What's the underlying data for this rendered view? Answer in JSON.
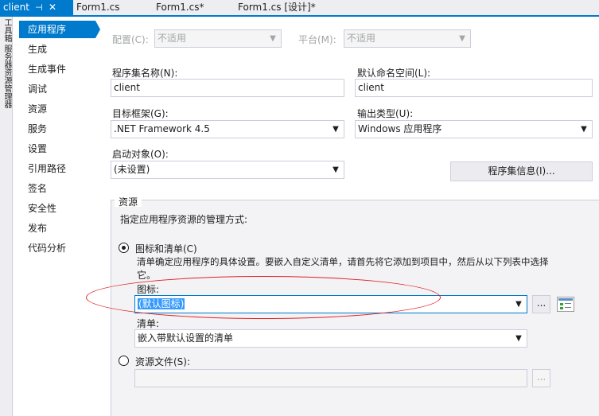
{
  "tabs": [
    {
      "label": "client",
      "pin": "⊣",
      "close": "✕",
      "active": true
    },
    {
      "label": "Form1.cs"
    },
    {
      "label": "Form1.cs*"
    },
    {
      "label": "Form1.cs [设计]*"
    }
  ],
  "toolstrip": {
    "text": "工具箱  服务器资源管理器"
  },
  "nav": {
    "items": [
      {
        "label": "应用程序",
        "selected": true
      },
      {
        "label": "生成"
      },
      {
        "label": "生成事件"
      },
      {
        "label": "调试"
      },
      {
        "label": "资源"
      },
      {
        "label": "服务"
      },
      {
        "label": "设置"
      },
      {
        "label": "引用路径"
      },
      {
        "label": "签名"
      },
      {
        "label": "安全性"
      },
      {
        "label": "发布"
      },
      {
        "label": "代码分析"
      }
    ]
  },
  "config": {
    "label": "配置(C):",
    "value": "不适用"
  },
  "platform": {
    "label": "平台(M):",
    "value": "不适用"
  },
  "assembly_name": {
    "label": "程序集名称(N):",
    "value": "client"
  },
  "default_namespace": {
    "label": "默认命名空间(L):",
    "value": "client"
  },
  "target_framework": {
    "label": "目标框架(G):",
    "value": ".NET Framework 4.5"
  },
  "output_type": {
    "label": "输出类型(U):",
    "value": "Windows 应用程序"
  },
  "startup_object": {
    "label": "启动对象(O):",
    "value": "(未设置)"
  },
  "assembly_info_button": "程序集信息(I)...",
  "resources": {
    "group_title": "资源",
    "description": "指定应用程序资源的管理方式:",
    "icon_manifest_option": "图标和清单(C)",
    "icon_manifest_desc_1": "清单确定应用程序的具体设置。要嵌入自定义清单，请首先将它添加到项目中，然后从以下列表中选择",
    "icon_manifest_desc_2": "它。",
    "icon_label": "图标:",
    "icon_value": "(默认图标)",
    "browse_label": "...",
    "manifest_label": "清单:",
    "manifest_value": "嵌入带默认设置的清单",
    "resource_file_option": "资源文件(S):",
    "resource_file_value": "",
    "resource_browse_label": "..."
  },
  "colors": {
    "accent": "#007acc",
    "annotation": "#e02020"
  }
}
